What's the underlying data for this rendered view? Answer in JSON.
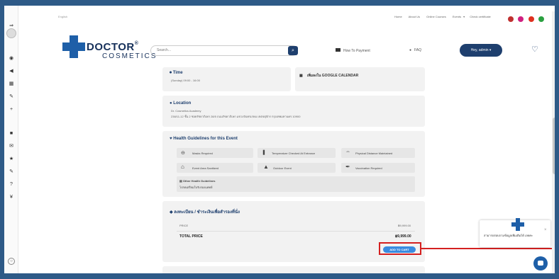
{
  "top_bar": {
    "language": "English",
    "nav": [
      "Home",
      "About Us",
      "Online Courses",
      "Events",
      "Check certificate"
    ],
    "social_colors": [
      "#c03030",
      "#d02080",
      "#e03020",
      "#2aa040"
    ]
  },
  "logo": {
    "word": "DOCTOR",
    "reg": "®",
    "sub": "COSMETICS"
  },
  "header": {
    "search_placeholder": "Search...",
    "how_to_payment": "How To Payment",
    "faq": "FAQ",
    "user": "Hey, admin"
  },
  "time": {
    "title": "Time",
    "value": "(Sunday) 09:00 - 16:00",
    "calendar": "เพิ่มลงใน GOOGLE CALENDAR"
  },
  "location": {
    "title": "Location",
    "name": "Dr. Cosmetics Academy",
    "address": "238/11-12 ชั้น 2 ซอยรัชดาภิเษก 28/5 ถนนรัชดาภิเษก แขวงจันทรเกษม เขตจตุจักร กรุงเทพมหานคร 10900"
  },
  "guidelines": {
    "title": "Health Guidelines for this Event",
    "items": [
      "Masks Required",
      "Temperature Checked At Entrance",
      "Physical Distance Maintained",
      "Event Area Sanitized",
      "Outdoor Event",
      "Vaccination Required"
    ],
    "other_title": "Other Health Guidelines",
    "other_text": "โปรดเตรียมใบรับรองแพทย์"
  },
  "register": {
    "title": "ลงทะเบียน / ชำระเงินเพื่อสำรองที่นั่ง",
    "price_label": "PRICE",
    "price_value": "฿9,999.00",
    "total_label": "TOTAL PRICE",
    "total_value": "฿9,999.00",
    "add_to_cart": "ADD TO CART"
  },
  "chat": {
    "message": "สามารถสอบถามข้อมูลเพิ่มเติมได้ เลยค่ะ"
  }
}
